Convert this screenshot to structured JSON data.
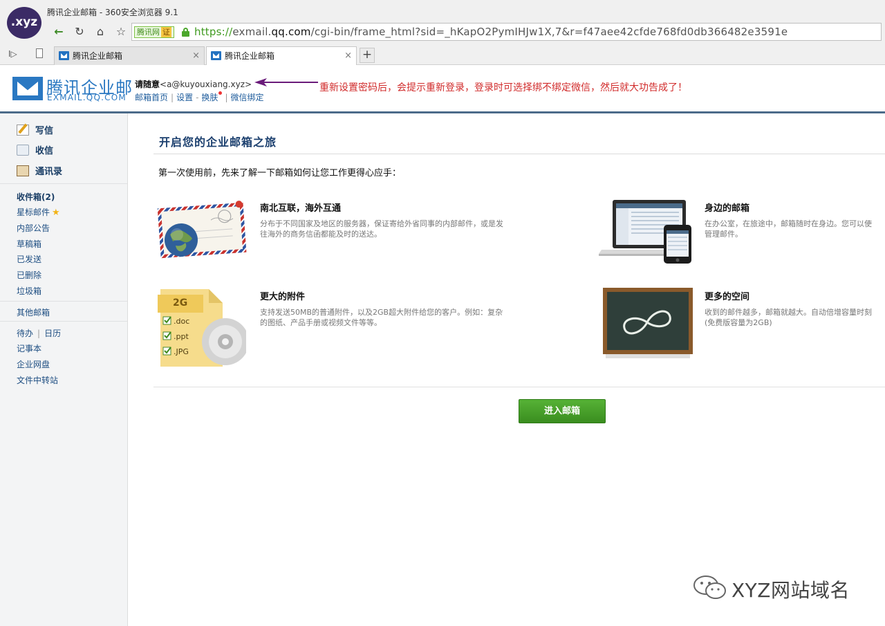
{
  "browser": {
    "logo_text": ".xyz",
    "window_title": "腾讯企业邮箱 - 360安全浏览器 9.1",
    "address": {
      "verify_label": "腾讯网",
      "verify_badge": "证",
      "url_scheme": "https://",
      "url_domain_pre": "exmail.",
      "url_domain": "qq.com",
      "url_path": "/cgi-bin/frame_html?sid=_hKapO2PymIHJw1X,7&r=f47aee42cfde768fd0db366482e3591e"
    },
    "tabs": [
      {
        "label": "腾讯企业邮箱",
        "close": "×"
      },
      {
        "label": "腾讯企业邮箱",
        "close": "×"
      }
    ],
    "new_tab": "+",
    "nav_icons": {
      "back": "←",
      "refresh": "↻",
      "home": "⌂",
      "star": "☆",
      "sidebar_toggle": "I▷"
    }
  },
  "header": {
    "brand_name": "腾讯企业邮",
    "brand_sub": "EXMAIL.QQ.COM",
    "user_name": "请随意",
    "user_email": "<a@kuyouxiang.xyz>",
    "links": [
      "邮箱首页",
      "设置",
      "换肤",
      "微信绑定"
    ],
    "link_dash": "-",
    "link_sep": "|"
  },
  "annotation": {
    "text": "重新设置密码后，会提示重新登录，登录时可选择绑不绑定微信，然后就大功告成了！",
    "color": "#d12b2b",
    "arrow_color": "#6a1b7a"
  },
  "sidebar": {
    "main": [
      {
        "label": "写信",
        "icon": "compose-icon"
      },
      {
        "label": "收信",
        "icon": "inbox-icon"
      },
      {
        "label": "通讯录",
        "icon": "contacts-icon"
      }
    ],
    "folders": {
      "inbox": "收件箱(2)",
      "starred": "星标邮件",
      "notice": "内部公告",
      "drafts": "草稿箱",
      "sent": "已发送",
      "deleted": "已删除",
      "spam": "垃圾箱"
    },
    "other_mailbox": "其他邮箱",
    "tools": {
      "todo": "待办",
      "calendar": "日历",
      "sep": "|",
      "notes": "记事本",
      "disk": "企业网盘",
      "transfer": "文件中转站"
    }
  },
  "main": {
    "title": "开启您的企业邮箱之旅",
    "intro": "第一次使用前，先来了解一下邮箱如何让您工作更得心应手：",
    "features": [
      {
        "title": "南北互联，海外互通",
        "desc1": "分布于不同国家及地区的服务器，保证寄给外省同事的内部邮件，或是发",
        "desc2": "往海外的商务信函都能及时的送达。"
      },
      {
        "title": "身边的邮箱",
        "desc1": "在办公室，在旅途中，邮箱随时在身边。您可以使",
        "desc2": "管理邮件。"
      },
      {
        "title": "更大的附件",
        "desc1": "支持发送50MB的普通附件，以及2GB超大附件给您的客户。例如：复杂",
        "desc2": "的图纸、产品手册或视频文件等等。"
      },
      {
        "title": "更多的空间",
        "desc1": "收到的邮件越多，邮箱就越大。自动倍增容量时刻",
        "desc2": "(免费版容量为2GB)"
      }
    ],
    "attach_labels": {
      "size": "2G",
      "doc": ".doc",
      "ppt": ".ppt",
      "jpg": ".JPG"
    },
    "enter_button": "进入邮箱"
  },
  "watermark": {
    "text": "XYZ网站域名"
  },
  "colors": {
    "brand": "#2a78c2",
    "header_bar": "#4b6b8a",
    "button_green": "#4aa12b",
    "link": "#1e5c9c"
  }
}
